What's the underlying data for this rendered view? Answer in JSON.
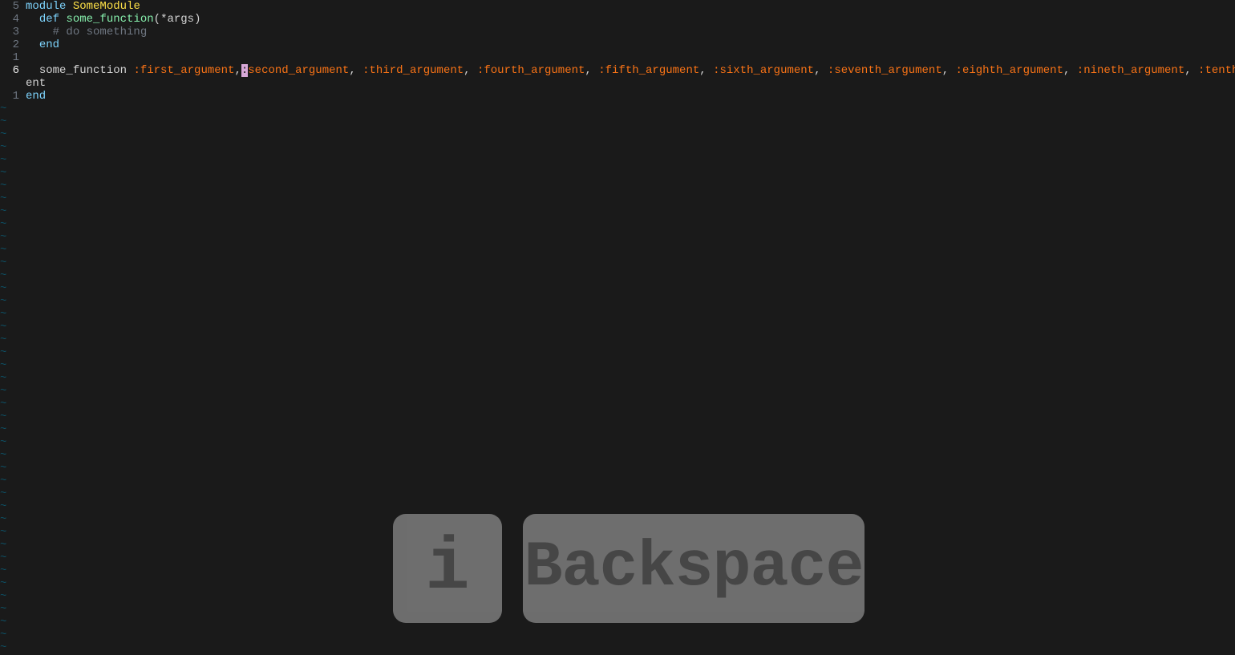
{
  "gutter": {
    "l1": "5",
    "l2": "4",
    "l3": "3",
    "l4": "2",
    "l5": "1",
    "l6": "6",
    "l7_wrap": "",
    "l8": "1"
  },
  "tokens": {
    "indent2": "  ",
    "indent4": "    ",
    "module_kw": "module",
    "space": " ",
    "module_name": "SomeModule",
    "def_kw": "def",
    "func_def_name": "some_function",
    "paren_open": "(",
    "star": "*",
    "args_param": "args",
    "paren_close": ")",
    "comment": "# do something",
    "end_kw": "end",
    "func_call": "some_function ",
    "colon": ":",
    "comma_sp": ", ",
    "comma": ",",
    "cursor_char": ":",
    "arg1": "first_argument",
    "arg2": "second_argument",
    "arg3": "third_argument",
    "arg4": "fourth_argument",
    "arg5": "fifth_argument",
    "arg6": "sixth_argument",
    "arg7": "seventh_argument",
    "arg8": "eighth_argument",
    "arg9": "nineth_argument",
    "arg10_head": "tenth_argum",
    "line7_wrap_ent": "ent"
  },
  "tilde": "~",
  "keycast": {
    "key1": "i",
    "key2": "Backspace"
  }
}
